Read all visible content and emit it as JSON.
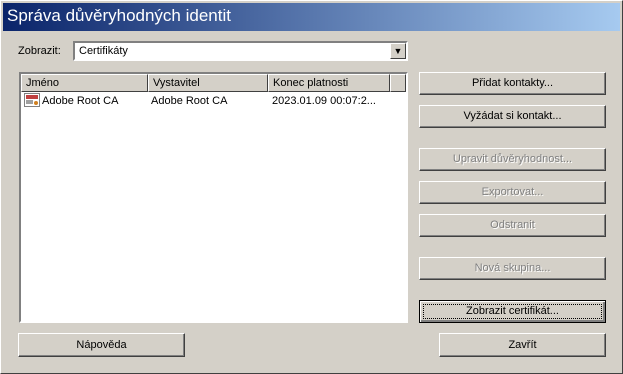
{
  "window": {
    "title": "Správa důvěryhodných identit"
  },
  "filter": {
    "label": "Zobrazit:",
    "selected": "Certifikáty"
  },
  "table": {
    "columns": [
      "Jméno",
      "Vystavitel",
      "Konec platnosti"
    ],
    "rows": [
      {
        "name": "Adobe Root CA",
        "issuer": "Adobe Root CA",
        "expires": "2023.01.09 00:07:2..."
      }
    ]
  },
  "buttons": {
    "add_contacts": "Přidat kontakty...",
    "request_contact": "Vyžádat si kontakt...",
    "edit_trust": "Upravit důvěryhodnost...",
    "export": "Exportovat...",
    "remove": "Odstranit",
    "new_group": "Nová skupina...",
    "show_certificate": "Zobrazit certifikát...",
    "help": "Nápověda",
    "close": "Zavřít"
  }
}
